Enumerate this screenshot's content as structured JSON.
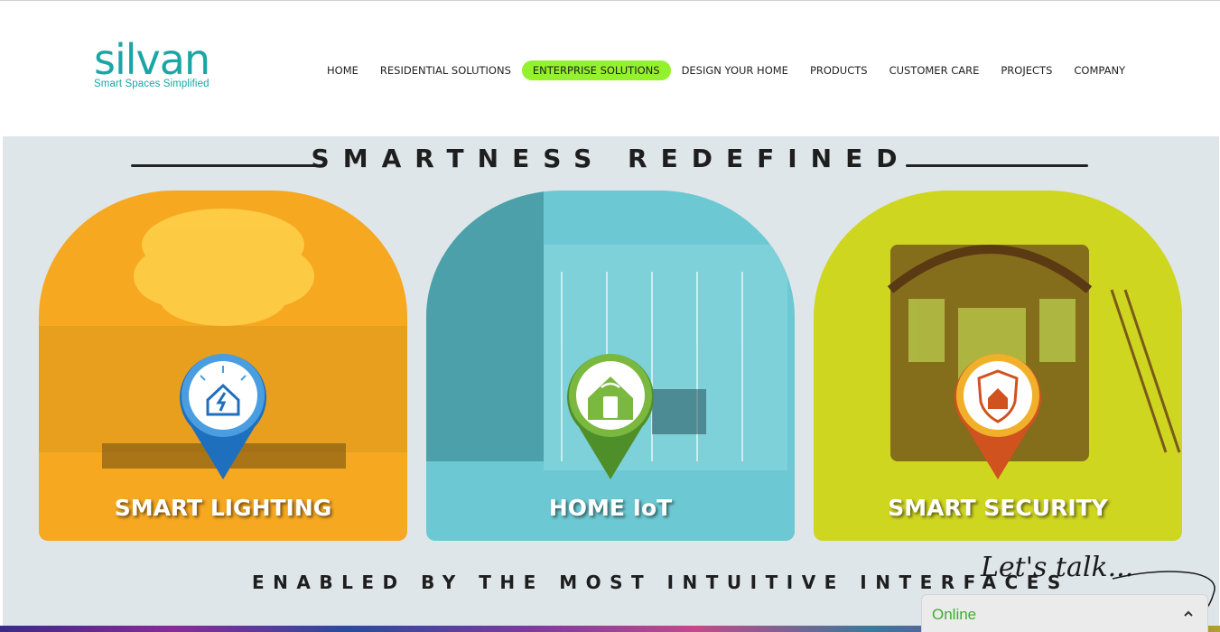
{
  "brand": {
    "logo_word": "silvan",
    "tagline": "Smart Spaces Simplified",
    "color": "#1aa6a6"
  },
  "nav": {
    "items": [
      {
        "label": "HOME"
      },
      {
        "label": "RESIDENTIAL SOLUTIONS"
      },
      {
        "label": "ENTERPRISE SOLUTIONS",
        "active": true
      },
      {
        "label": "DESIGN YOUR HOME"
      },
      {
        "label": "PRODUCTS"
      },
      {
        "label": "CUSTOMER CARE"
      },
      {
        "label": "PROJECTS"
      },
      {
        "label": "COMPANY"
      }
    ],
    "active_color": "#93f22c"
  },
  "hero": {
    "title": "SMARTNESS REDEFINED",
    "subtitle": "ENABLED BY THE MOST INTUITIVE INTERFACES",
    "cards": [
      {
        "label": "SMART LIGHTING",
        "color": "#f6a821",
        "icon": "smart-lighting-pin-icon"
      },
      {
        "label": "HOME IoT",
        "color": "#6cc9d3",
        "icon": "home-iot-pin-icon"
      },
      {
        "label": "SMART SECURITY",
        "color": "#cfd620",
        "icon": "smart-security-pin-icon"
      }
    ]
  },
  "chat": {
    "prompt": "Let's talk...",
    "status": "Online",
    "toggle_icon": "chevron-up-icon"
  }
}
